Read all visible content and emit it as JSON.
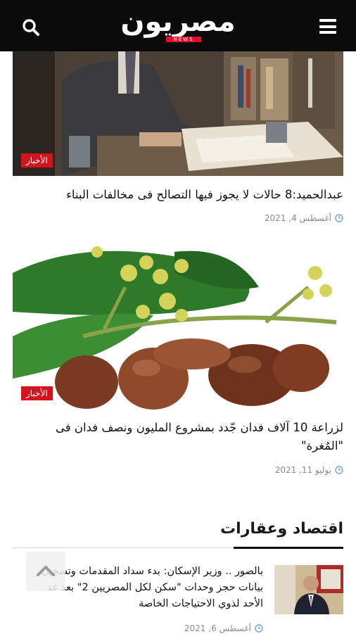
{
  "header": {
    "logo_text": "مصريون",
    "logo_subtext": "NEWS",
    "menu_icon": "hamburger-menu-icon",
    "search_icon": "search-icon",
    "background": "#0b0b0b",
    "accent": "#e0102b"
  },
  "articles": [
    {
      "category": "الأخبار",
      "title": "عبدالحميد:8 حالات لا يجوز فيها التصالح فى مخالفات البناء",
      "date": "أغسطس 4, 2021"
    },
    {
      "category": "الأخبار",
      "title": "لزراعة 10 آلاف فدان جّدد بمشروع المليون ونصف فدان فى \"المُغرة\"",
      "date": "يوليو 11, 2021"
    }
  ],
  "section": {
    "title": "اقتصاد وعقارات",
    "items": [
      {
        "title": "بالصور .. وزير الإسكان: بدء سداد المقدمات وتسجيل بيانات حجز وحدات \"سكن لكل المصريين 2\" بعد غد الأحد لذوي الاحتياجات الخاصة",
        "date": "أغسطس 6, 2021"
      }
    ]
  },
  "colors": {
    "badge": "#d6121e",
    "meta_text": "#8a8a8a",
    "clock_icon": "#6aa6d8"
  }
}
